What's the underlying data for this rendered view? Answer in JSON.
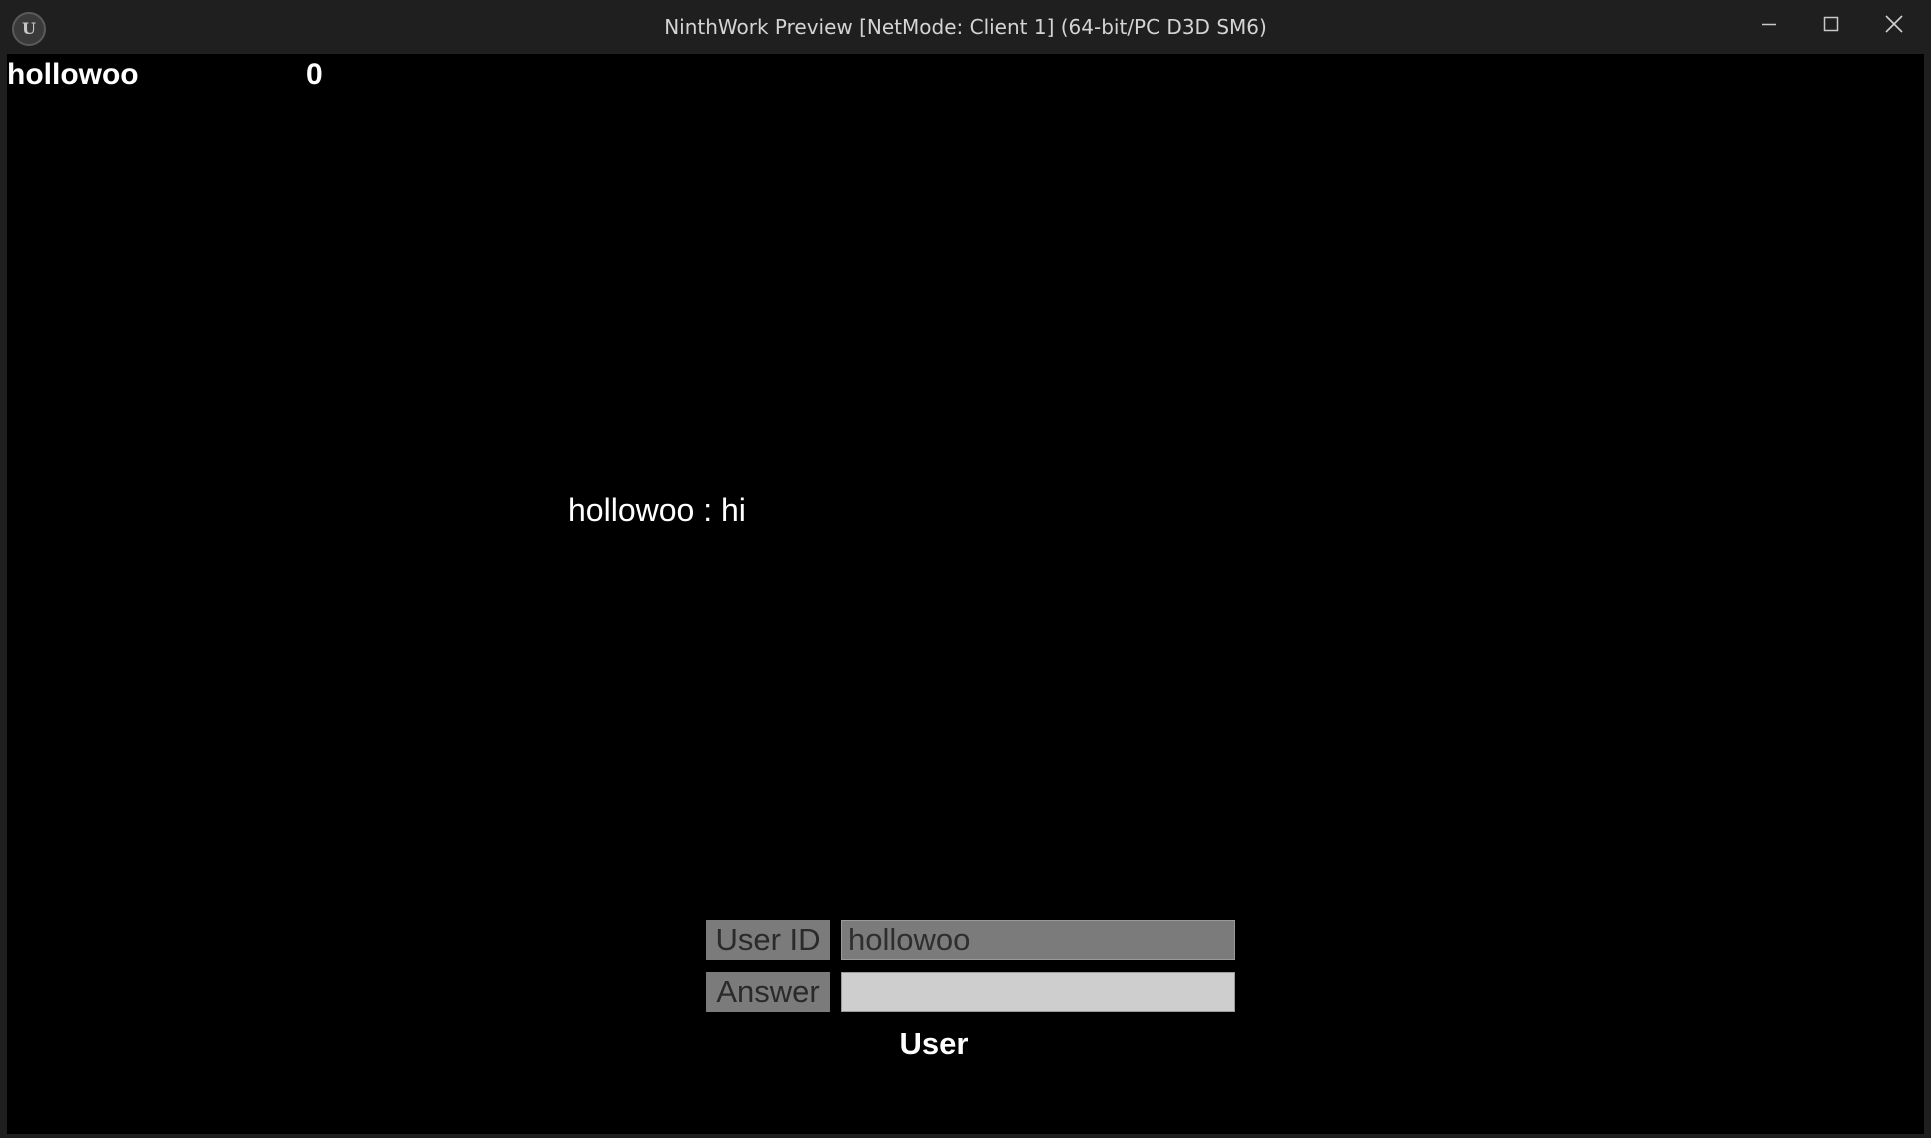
{
  "window": {
    "title": "NinthWork Preview [NetMode: Client 1]  (64-bit/PC D3D SM6)",
    "logo_text": "U",
    "controls": {
      "minimize_icon": "minimize-icon",
      "maximize_icon": "maximize-icon",
      "close_icon": "close-icon"
    }
  },
  "hud": {
    "player_name": "hollowoo",
    "score": "0"
  },
  "chat": {
    "message": "hollowoo : hi"
  },
  "form": {
    "user_id_label": "User ID",
    "user_id_value": "hollowoo",
    "answer_label": "Answer",
    "answer_value": "",
    "role_label": "User"
  },
  "colors": {
    "background": "#000000",
    "titlebar": "#1f1f1f",
    "label_bg": "#7b7b7b",
    "answer_bg": "#cecece",
    "text": "#ffffff"
  }
}
